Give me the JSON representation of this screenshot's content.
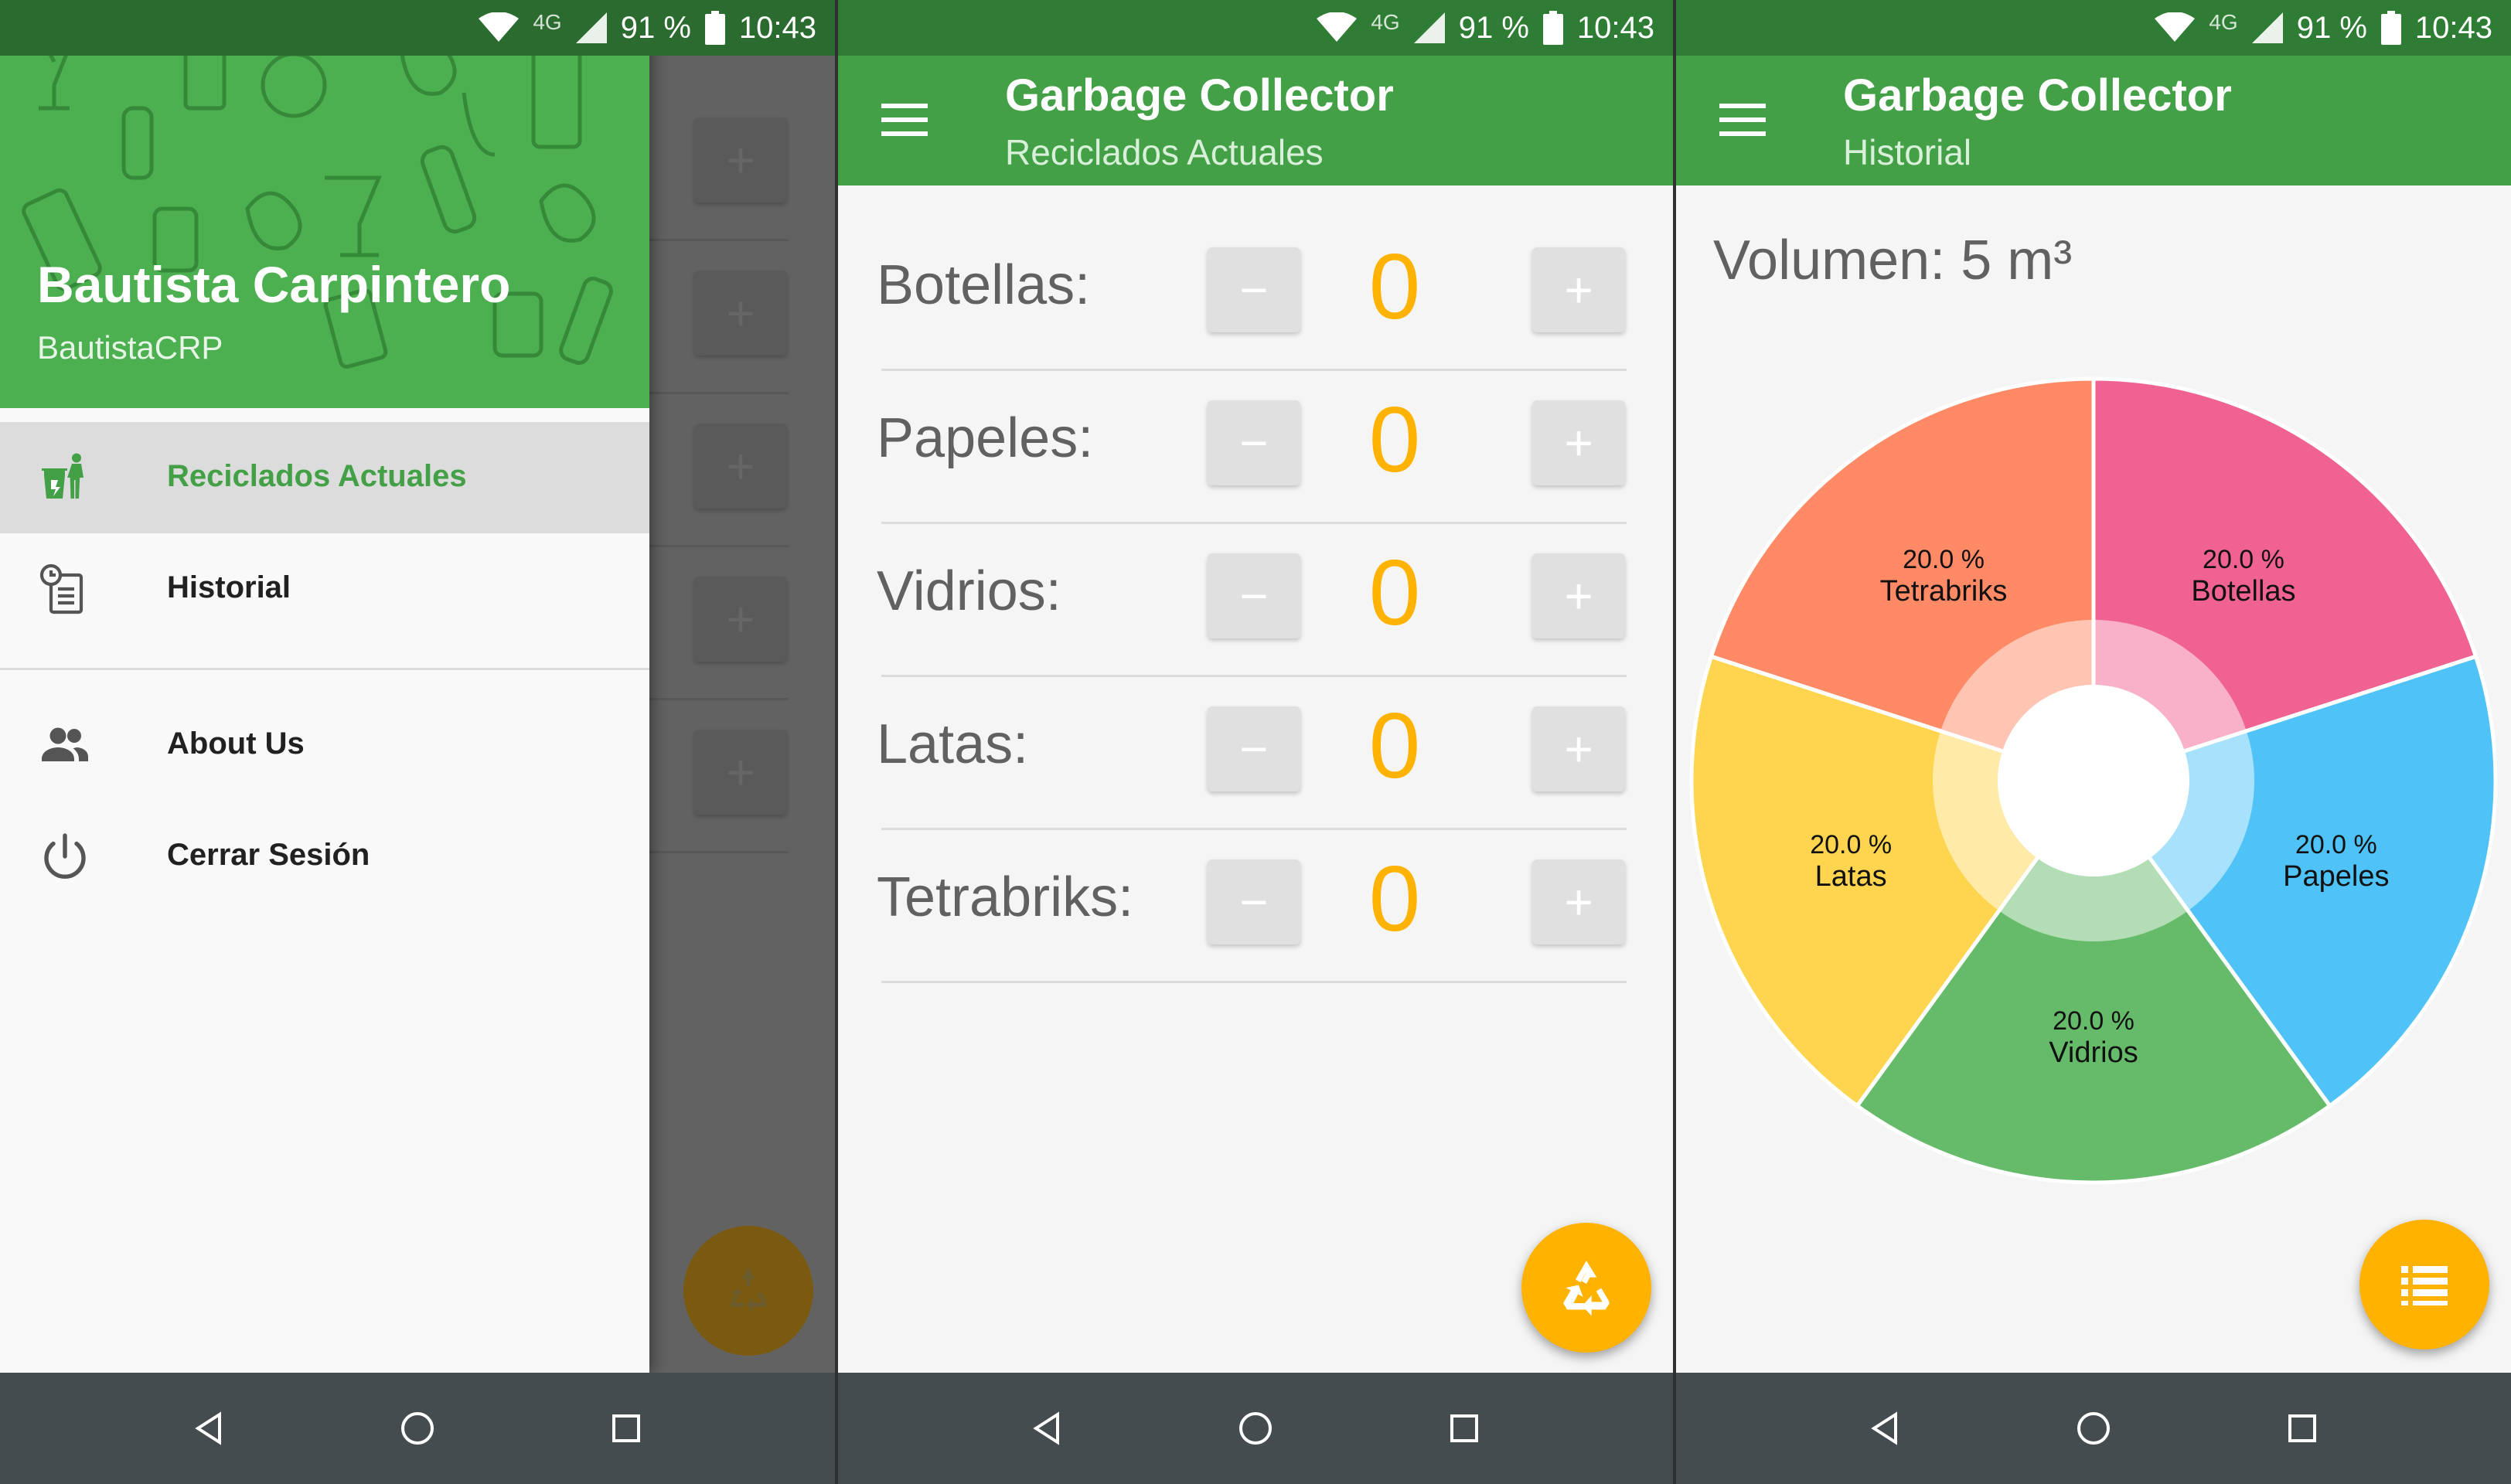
{
  "status_bar": {
    "network": "4G",
    "battery": "91 %",
    "time": "10:43"
  },
  "drawer": {
    "name": "Bautista Carpintero",
    "username": "BautistaCRP",
    "items": [
      {
        "label": "Reciclados Actuales",
        "icon": "recycle-person-icon",
        "selected": true
      },
      {
        "label": "Historial",
        "icon": "history-icon",
        "selected": false
      },
      {
        "label": "About Us",
        "icon": "people-icon",
        "selected": false
      },
      {
        "label": "Cerrar Sesión",
        "icon": "power-icon",
        "selected": false
      }
    ]
  },
  "counter_screen": {
    "title": "Garbage Collector",
    "subtitle": "Reciclados Actuales",
    "items": [
      {
        "label": "Botellas:",
        "value": "0"
      },
      {
        "label": "Papeles:",
        "value": "0"
      },
      {
        "label": "Vidrios:",
        "value": "0"
      },
      {
        "label": "Latas:",
        "value": "0"
      },
      {
        "label": "Tetrabriks:",
        "value": "0"
      }
    ],
    "minus": "−",
    "plus": "+"
  },
  "history_screen": {
    "title": "Garbage Collector",
    "subtitle": "Historial",
    "volume": "Volumen: 5 m³"
  },
  "colors": {
    "primary": "#43a047",
    "status": "#2f7d34",
    "accent": "#ffb300",
    "nav": "#454c50"
  },
  "chart_data": {
    "type": "pie",
    "title": "",
    "start_angle_deg": 0,
    "slices": [
      {
        "label": "Botellas",
        "value": 20.0,
        "text": "20.0 %",
        "color": "#f06292",
        "inner": "#f8b1c8"
      },
      {
        "label": "Papeles",
        "value": 20.0,
        "text": "20.0 %",
        "color": "#4fc3f7",
        "inner": "#a7e1fb"
      },
      {
        "label": "Vidrios",
        "value": 20.0,
        "text": "20.0 %",
        "color": "#66bb6a",
        "inner": "#b3ddb5"
      },
      {
        "label": "Latas",
        "value": 20.0,
        "text": "20.0 %",
        "color": "#ffd54f",
        "inner": "#ffeaa7"
      },
      {
        "label": "Tetrabriks",
        "value": 20.0,
        "text": "20.0 %",
        "color": "#ff8a65",
        "inner": "#ffc4b2"
      }
    ]
  }
}
